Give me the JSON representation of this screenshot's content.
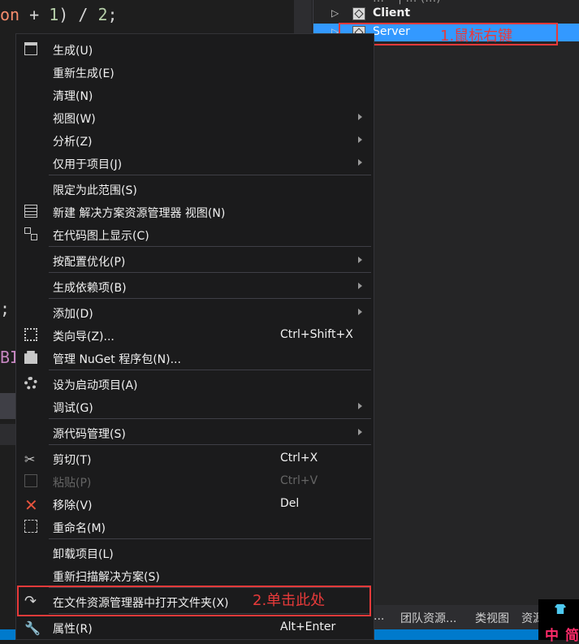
{
  "editor": {
    "code_line1": {
      "ident": "on",
      "op1": " + ",
      "num1": "1",
      "op2": ") / ",
      "num2": "2",
      "semi": ";"
    },
    "code_semicolon": ";",
    "code_fragment": "BI"
  },
  "explorer": {
    "top_row_partial": "… • | … (…)",
    "client_label": "Client",
    "server_label": "Server"
  },
  "annotations": {
    "step1": "1.鼠标右键",
    "step2": "2.单击此处",
    "color": "#e83a3a"
  },
  "bottom_tabs": [
    "...",
    "团队资源...",
    "类视图",
    "资源"
  ],
  "ime": {
    "chars": [
      "中",
      "简"
    ]
  },
  "context_menu": {
    "items": [
      {
        "label": "生成(U)",
        "icon": "build-icon"
      },
      {
        "label": "重新生成(E)"
      },
      {
        "label": "清理(N)"
      },
      {
        "label": "视图(W)",
        "submenu": true
      },
      {
        "label": "分析(Z)",
        "submenu": true
      },
      {
        "label": "仅用于项目(J)",
        "submenu": true
      },
      {
        "label": "限定为此范围(S)"
      },
      {
        "label": "新建 解决方案资源管理器 视图(N)",
        "icon": "new-view-icon"
      },
      {
        "label": "在代码图上显示(C)",
        "icon": "code-map-icon"
      },
      {
        "label": "按配置优化(P)",
        "submenu": true
      },
      {
        "label": "生成依赖项(B)",
        "submenu": true
      },
      {
        "label": "添加(D)",
        "submenu": true
      },
      {
        "label": "类向导(Z)...",
        "shortcut": "Ctrl+Shift+X",
        "icon": "class-wizard-icon"
      },
      {
        "label": "管理 NuGet 程序包(N)...",
        "icon": "nuget-icon"
      },
      {
        "label": "设为启动项目(A)",
        "icon": "gear-icon"
      },
      {
        "label": "调试(G)",
        "submenu": true
      },
      {
        "label": "源代码管理(S)",
        "submenu": true
      },
      {
        "label": "剪切(T)",
        "shortcut": "Ctrl+X",
        "icon": "scissors-icon"
      },
      {
        "label": "粘贴(P)",
        "shortcut": "Ctrl+V",
        "icon": "paste-icon",
        "disabled": true
      },
      {
        "label": "移除(V)",
        "shortcut": "Del",
        "icon": "remove-icon"
      },
      {
        "label": "重命名(M)",
        "icon": "rename-icon"
      },
      {
        "label": "卸载项目(L)"
      },
      {
        "label": "重新扫描解决方案(S)"
      },
      {
        "label": "在文件资源管理器中打开文件夹(X)",
        "icon": "open-folder-icon"
      },
      {
        "label": "属性(R)",
        "shortcut": "Alt+Enter",
        "icon": "wrench-icon"
      }
    ]
  }
}
